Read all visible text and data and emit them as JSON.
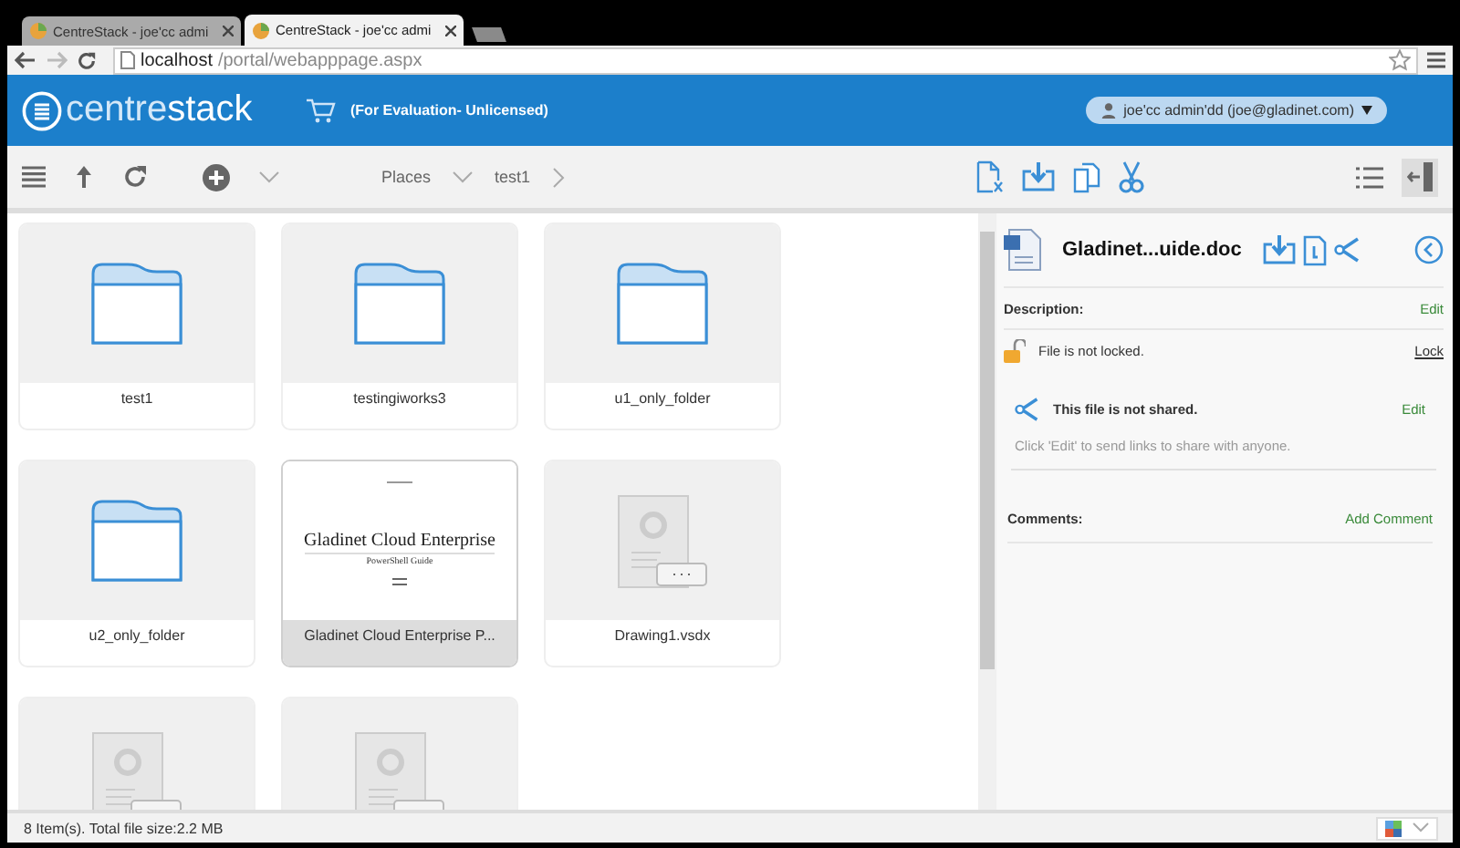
{
  "browser": {
    "tabs": [
      {
        "title": "CentreStack - joe'cc admi",
        "selected": false
      },
      {
        "title": "CentreStack - joe'cc admi",
        "selected": true
      }
    ],
    "url_host": "localhost",
    "url_path": "/portal/webapppage.aspx"
  },
  "header": {
    "logo_prefix": "centre",
    "logo_suffix": "stack",
    "license": "(For Evaluation- Unlicensed)",
    "user": "joe'cc admin'dd  (joe@gladinet.com)"
  },
  "breadcrumb": [
    {
      "label": "Places",
      "kind": "menu"
    },
    {
      "label": "test1",
      "kind": "crumb"
    }
  ],
  "files": [
    {
      "name": "test1",
      "kind": "folder",
      "selected": false
    },
    {
      "name": "testingiworks3",
      "kind": "folder",
      "selected": false
    },
    {
      "name": "u1_only_folder",
      "kind": "folder",
      "selected": false
    },
    {
      "name": "u2_only_folder",
      "kind": "folder",
      "selected": false
    },
    {
      "name": "Gladinet Cloud Enterprise P...",
      "kind": "document",
      "selected": true,
      "preview_title": "Gladinet Cloud Enterprise",
      "preview_subtitle": "PowerShell Guide"
    },
    {
      "name": "Drawing1.vsdx",
      "kind": "file",
      "selected": false
    },
    {
      "kind": "file",
      "selected": false
    },
    {
      "kind": "file",
      "selected": false
    }
  ],
  "details": {
    "filename": "Gladinet...uide.doc",
    "description_label": "Description:",
    "description_action": "Edit",
    "lock_status": "File is not locked.",
    "lock_action": "Lock",
    "share_status": "This file is not shared.",
    "share_action": "Edit",
    "share_hint": "Click 'Edit' to send links to share with anyone.",
    "comments_label": "Comments:",
    "comments_action": "Add Comment"
  },
  "status_bar": {
    "text": "8 Item(s). Total file size:2.2 MB"
  }
}
